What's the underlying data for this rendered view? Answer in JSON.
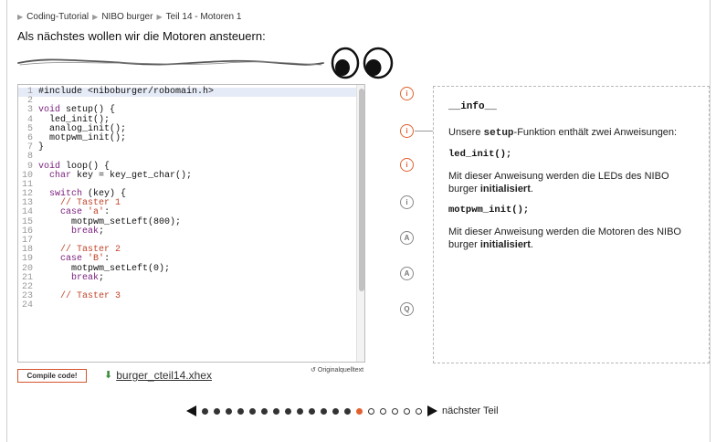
{
  "breadcrumb": {
    "items": [
      "Coding-Tutorial",
      "NIBO burger",
      "Teil 14 - Motoren 1"
    ],
    "separator": "▶"
  },
  "intro_text": "Als nächstes wollen wir die Motoren ansteuern:",
  "code": {
    "lines": [
      {
        "n": "1",
        "segs": [
          {
            "t": "#include <niboburger/robomain.h>",
            "c": "txt"
          }
        ]
      },
      {
        "n": "2",
        "segs": []
      },
      {
        "n": "3",
        "segs": [
          {
            "t": "void",
            "c": "kw"
          },
          {
            "t": " setup() {",
            "c": "txt"
          }
        ]
      },
      {
        "n": "4",
        "segs": [
          {
            "t": "  led_init();",
            "c": "txt"
          }
        ]
      },
      {
        "n": "5",
        "segs": [
          {
            "t": "  analog_init();",
            "c": "txt"
          }
        ]
      },
      {
        "n": "6",
        "segs": [
          {
            "t": "  motpwm_init();",
            "c": "txt"
          }
        ]
      },
      {
        "n": "7",
        "segs": [
          {
            "t": "}",
            "c": "txt"
          }
        ]
      },
      {
        "n": "8",
        "segs": []
      },
      {
        "n": "9",
        "segs": [
          {
            "t": "void",
            "c": "kw"
          },
          {
            "t": " loop() {",
            "c": "txt"
          }
        ]
      },
      {
        "n": "10",
        "segs": [
          {
            "t": "  ",
            "c": "txt"
          },
          {
            "t": "char",
            "c": "kw"
          },
          {
            "t": " key = key_get_char();",
            "c": "txt"
          }
        ]
      },
      {
        "n": "11",
        "segs": []
      },
      {
        "n": "12",
        "segs": [
          {
            "t": "  ",
            "c": "txt"
          },
          {
            "t": "switch",
            "c": "kw"
          },
          {
            "t": " (key) {",
            "c": "txt"
          }
        ]
      },
      {
        "n": "13",
        "segs": [
          {
            "t": "    // Taster 1",
            "c": "cm"
          }
        ]
      },
      {
        "n": "14",
        "segs": [
          {
            "t": "    ",
            "c": "txt"
          },
          {
            "t": "case",
            "c": "kw"
          },
          {
            "t": " ",
            "c": "txt"
          },
          {
            "t": "'a'",
            "c": "str"
          },
          {
            "t": ":",
            "c": "txt"
          }
        ]
      },
      {
        "n": "15",
        "segs": [
          {
            "t": "      motpwm_setLeft(800);",
            "c": "txt"
          }
        ]
      },
      {
        "n": "16",
        "segs": [
          {
            "t": "      ",
            "c": "txt"
          },
          {
            "t": "break",
            "c": "kw"
          },
          {
            "t": ";",
            "c": "txt"
          }
        ]
      },
      {
        "n": "17",
        "segs": []
      },
      {
        "n": "18",
        "segs": [
          {
            "t": "    // Taster 2",
            "c": "cm"
          }
        ]
      },
      {
        "n": "19",
        "segs": [
          {
            "t": "    ",
            "c": "txt"
          },
          {
            "t": "case",
            "c": "kw"
          },
          {
            "t": " ",
            "c": "txt"
          },
          {
            "t": "'B'",
            "c": "str"
          },
          {
            "t": ":",
            "c": "txt"
          }
        ]
      },
      {
        "n": "20",
        "segs": [
          {
            "t": "      motpwm_setLeft(0);",
            "c": "txt"
          }
        ]
      },
      {
        "n": "21",
        "segs": [
          {
            "t": "      ",
            "c": "txt"
          },
          {
            "t": "break",
            "c": "kw"
          },
          {
            "t": ";",
            "c": "txt"
          }
        ]
      },
      {
        "n": "22",
        "segs": []
      },
      {
        "n": "23",
        "segs": [
          {
            "t": "    // Taster 3",
            "c": "cm"
          }
        ]
      },
      {
        "n": "24",
        "segs": []
      }
    ],
    "active_line": "1"
  },
  "compile_label": "Compile code!",
  "download_label": "burger_cteil14.xhex",
  "original_label": "Originalquelltext",
  "original_glyph": "↺",
  "notes": [
    {
      "letter": "i",
      "state": "active"
    },
    {
      "letter": "i",
      "state": "active"
    },
    {
      "letter": "i",
      "state": "active"
    },
    {
      "letter": "i",
      "state": "inactive"
    },
    {
      "letter": "A",
      "state": "inactive"
    },
    {
      "letter": "A",
      "state": "inactive"
    },
    {
      "letter": "Q",
      "state": "inactive"
    }
  ],
  "info": {
    "title": "__info__",
    "p1_pre": "Unsere ",
    "p1_code": "setup",
    "p1_post": "-Funktion enthält zwei Anweisungen:",
    "code1": "led_init();",
    "p2_pre": "Mit dieser Anweisung werden die LEDs des NIBO burger ",
    "p2_bold": "initialisiert",
    "p2_post": ".",
    "code2": "motpwm_init();",
    "p3_pre": "Mit dieser Anweisung werden die Motoren des NIBO burger ",
    "p3_bold": "initialisiert",
    "p3_post": "."
  },
  "pagination": {
    "total": 19,
    "current": 14,
    "next_label": "nächster Teil"
  },
  "colors": {
    "accent": "#e0612f",
    "keyword": "#7a1d7d",
    "comment": "#c1442b"
  }
}
